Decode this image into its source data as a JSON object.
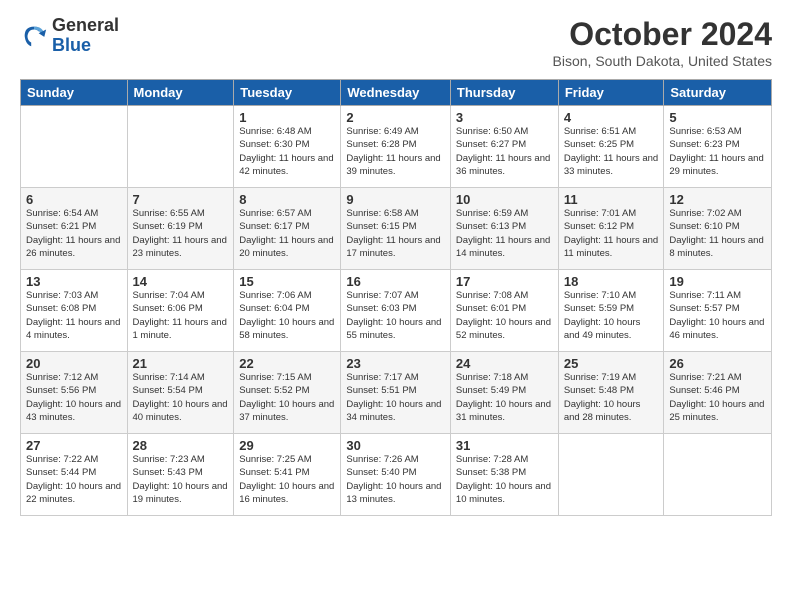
{
  "logo": {
    "general": "General",
    "blue": "Blue"
  },
  "title": "October 2024",
  "location": "Bison, South Dakota, United States",
  "days_of_week": [
    "Sunday",
    "Monday",
    "Tuesday",
    "Wednesday",
    "Thursday",
    "Friday",
    "Saturday"
  ],
  "weeks": [
    [
      {
        "day": "",
        "info": ""
      },
      {
        "day": "",
        "info": ""
      },
      {
        "day": "1",
        "info": "Sunrise: 6:48 AM\nSunset: 6:30 PM\nDaylight: 11 hours and 42 minutes."
      },
      {
        "day": "2",
        "info": "Sunrise: 6:49 AM\nSunset: 6:28 PM\nDaylight: 11 hours and 39 minutes."
      },
      {
        "day": "3",
        "info": "Sunrise: 6:50 AM\nSunset: 6:27 PM\nDaylight: 11 hours and 36 minutes."
      },
      {
        "day": "4",
        "info": "Sunrise: 6:51 AM\nSunset: 6:25 PM\nDaylight: 11 hours and 33 minutes."
      },
      {
        "day": "5",
        "info": "Sunrise: 6:53 AM\nSunset: 6:23 PM\nDaylight: 11 hours and 29 minutes."
      }
    ],
    [
      {
        "day": "6",
        "info": "Sunrise: 6:54 AM\nSunset: 6:21 PM\nDaylight: 11 hours and 26 minutes."
      },
      {
        "day": "7",
        "info": "Sunrise: 6:55 AM\nSunset: 6:19 PM\nDaylight: 11 hours and 23 minutes."
      },
      {
        "day": "8",
        "info": "Sunrise: 6:57 AM\nSunset: 6:17 PM\nDaylight: 11 hours and 20 minutes."
      },
      {
        "day": "9",
        "info": "Sunrise: 6:58 AM\nSunset: 6:15 PM\nDaylight: 11 hours and 17 minutes."
      },
      {
        "day": "10",
        "info": "Sunrise: 6:59 AM\nSunset: 6:13 PM\nDaylight: 11 hours and 14 minutes."
      },
      {
        "day": "11",
        "info": "Sunrise: 7:01 AM\nSunset: 6:12 PM\nDaylight: 11 hours and 11 minutes."
      },
      {
        "day": "12",
        "info": "Sunrise: 7:02 AM\nSunset: 6:10 PM\nDaylight: 11 hours and 8 minutes."
      }
    ],
    [
      {
        "day": "13",
        "info": "Sunrise: 7:03 AM\nSunset: 6:08 PM\nDaylight: 11 hours and 4 minutes."
      },
      {
        "day": "14",
        "info": "Sunrise: 7:04 AM\nSunset: 6:06 PM\nDaylight: 11 hours and 1 minute."
      },
      {
        "day": "15",
        "info": "Sunrise: 7:06 AM\nSunset: 6:04 PM\nDaylight: 10 hours and 58 minutes."
      },
      {
        "day": "16",
        "info": "Sunrise: 7:07 AM\nSunset: 6:03 PM\nDaylight: 10 hours and 55 minutes."
      },
      {
        "day": "17",
        "info": "Sunrise: 7:08 AM\nSunset: 6:01 PM\nDaylight: 10 hours and 52 minutes."
      },
      {
        "day": "18",
        "info": "Sunrise: 7:10 AM\nSunset: 5:59 PM\nDaylight: 10 hours and 49 minutes."
      },
      {
        "day": "19",
        "info": "Sunrise: 7:11 AM\nSunset: 5:57 PM\nDaylight: 10 hours and 46 minutes."
      }
    ],
    [
      {
        "day": "20",
        "info": "Sunrise: 7:12 AM\nSunset: 5:56 PM\nDaylight: 10 hours and 43 minutes."
      },
      {
        "day": "21",
        "info": "Sunrise: 7:14 AM\nSunset: 5:54 PM\nDaylight: 10 hours and 40 minutes."
      },
      {
        "day": "22",
        "info": "Sunrise: 7:15 AM\nSunset: 5:52 PM\nDaylight: 10 hours and 37 minutes."
      },
      {
        "day": "23",
        "info": "Sunrise: 7:17 AM\nSunset: 5:51 PM\nDaylight: 10 hours and 34 minutes."
      },
      {
        "day": "24",
        "info": "Sunrise: 7:18 AM\nSunset: 5:49 PM\nDaylight: 10 hours and 31 minutes."
      },
      {
        "day": "25",
        "info": "Sunrise: 7:19 AM\nSunset: 5:48 PM\nDaylight: 10 hours and 28 minutes."
      },
      {
        "day": "26",
        "info": "Sunrise: 7:21 AM\nSunset: 5:46 PM\nDaylight: 10 hours and 25 minutes."
      }
    ],
    [
      {
        "day": "27",
        "info": "Sunrise: 7:22 AM\nSunset: 5:44 PM\nDaylight: 10 hours and 22 minutes."
      },
      {
        "day": "28",
        "info": "Sunrise: 7:23 AM\nSunset: 5:43 PM\nDaylight: 10 hours and 19 minutes."
      },
      {
        "day": "29",
        "info": "Sunrise: 7:25 AM\nSunset: 5:41 PM\nDaylight: 10 hours and 16 minutes."
      },
      {
        "day": "30",
        "info": "Sunrise: 7:26 AM\nSunset: 5:40 PM\nDaylight: 10 hours and 13 minutes."
      },
      {
        "day": "31",
        "info": "Sunrise: 7:28 AM\nSunset: 5:38 PM\nDaylight: 10 hours and 10 minutes."
      },
      {
        "day": "",
        "info": ""
      },
      {
        "day": "",
        "info": ""
      }
    ]
  ]
}
